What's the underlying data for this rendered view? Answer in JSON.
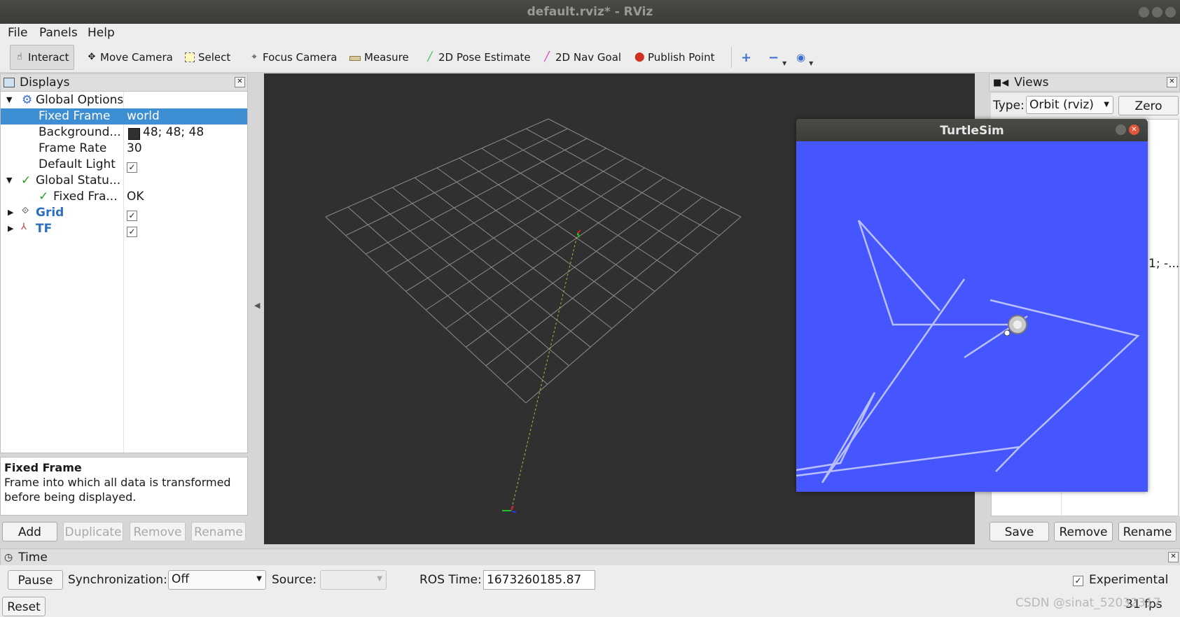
{
  "window": {
    "title": "default.rviz* - RViz"
  },
  "menu": [
    "File",
    "Panels",
    "Help"
  ],
  "toolbar": {
    "tools": [
      {
        "label": "Interact",
        "icon": "hand-icon"
      },
      {
        "label": "Move Camera",
        "icon": "move-camera-icon"
      },
      {
        "label": "Select",
        "icon": "select-icon"
      },
      {
        "label": "Focus Camera",
        "icon": "focus-camera-icon"
      },
      {
        "label": "Measure",
        "icon": "ruler-icon"
      },
      {
        "label": "2D Pose Estimate",
        "icon": "pose-arrow-icon"
      },
      {
        "label": "2D Nav Goal",
        "icon": "nav-goal-arrow-icon"
      },
      {
        "label": "Publish Point",
        "icon": "map-pin-icon"
      }
    ]
  },
  "displays": {
    "title": "Displays",
    "global_options": "Global Options",
    "rows": [
      {
        "key": "Fixed Frame",
        "value": "world"
      },
      {
        "key": "Background...",
        "value": "48; 48; 48"
      },
      {
        "key": "Frame Rate",
        "value": "30"
      },
      {
        "key": "Default Light",
        "value": ""
      }
    ],
    "global_status": "Global Statu...",
    "fixed_frame_status": {
      "key": "Fixed Fra...",
      "value": "OK"
    },
    "grid": "Grid",
    "tf": "TF",
    "description_title": "Fixed Frame",
    "description_text": "Frame into which all data is transformed before being displayed.",
    "buttons": {
      "add": "Add",
      "duplicate": "Duplicate",
      "remove": "Remove",
      "rename": "Rename"
    }
  },
  "views": {
    "title": "Views",
    "type_label": "Type:",
    "type_value": "Orbit (rviz)",
    "zero": "Zero",
    "partial_text": "1; -...",
    "buttons": {
      "save": "Save",
      "remove": "Remove",
      "rename": "Rename"
    }
  },
  "turtlesim": {
    "title": "TurtleSim",
    "background": "#4556ff"
  },
  "time": {
    "title": "Time",
    "pause": "Pause",
    "sync_label": "Synchronization:",
    "sync_value": "Off",
    "source_label": "Source:",
    "ros_time_label": "ROS Time:",
    "ros_time_value": "1673260185.87",
    "experimental": "Experimental",
    "reset": "Reset",
    "fps": "31 fps"
  },
  "watermark": "CSDN @sinat_52032317",
  "colors": {
    "accent": "#3d8ed3",
    "viewport": "#303030",
    "turtle_bg": "#4556ff"
  }
}
